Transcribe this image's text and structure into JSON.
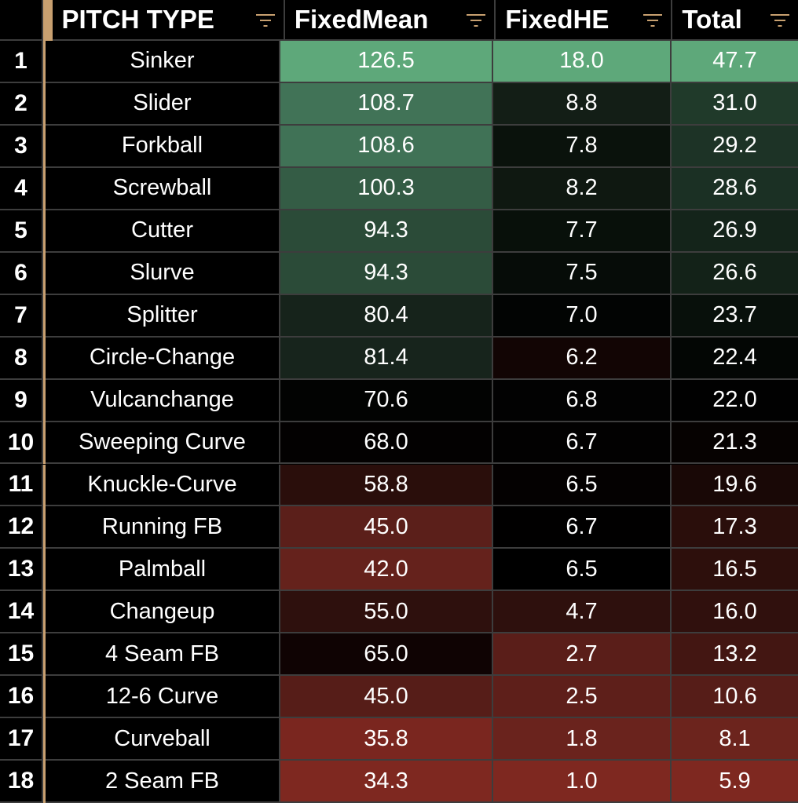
{
  "headers": {
    "pitch_type": "PITCH TYPE",
    "fixed_mean": "FixedMean",
    "fixed_he": "FixedHE",
    "total": "Total"
  },
  "colors": {
    "filter_icon": "#c8a070",
    "freeze_divider": "#c8a070",
    "grid_line": "#3d3d3d",
    "scale_high": "#5ea87a",
    "scale_mid": "#000000",
    "scale_low": "#7e2820"
  },
  "rows": [
    {
      "num": "1",
      "name": "Sinker",
      "fm": "126.5",
      "he": "18.0",
      "tot": "47.7",
      "fm_bg": "#5ea87a",
      "he_bg": "#5ea87a",
      "tot_bg": "#5ea87a"
    },
    {
      "num": "2",
      "name": "Slider",
      "fm": "108.7",
      "he": "8.8",
      "tot": "31.0",
      "fm_bg": "#417357",
      "he_bg": "#131e16",
      "tot_bg": "#203a2a"
    },
    {
      "num": "3",
      "name": "Forkball",
      "fm": "108.6",
      "he": "7.8",
      "tot": "29.2",
      "fm_bg": "#407256",
      "he_bg": "#0a120c",
      "tot_bg": "#1d3326"
    },
    {
      "num": "4",
      "name": "Screwball",
      "fm": "100.3",
      "he": "8.2",
      "tot": "28.6",
      "fm_bg": "#345c45",
      "he_bg": "#0f1811",
      "tot_bg": "#1b3024"
    },
    {
      "num": "5",
      "name": "Cutter",
      "fm": "94.3",
      "he": "7.7",
      "tot": "26.9",
      "fm_bg": "#2b4b38",
      "he_bg": "#08100a",
      "tot_bg": "#14241a"
    },
    {
      "num": "6",
      "name": "Slurve",
      "fm": "94.3",
      "he": "7.5",
      "tot": "26.6",
      "fm_bg": "#2b4b38",
      "he_bg": "#060c08",
      "tot_bg": "#132218"
    },
    {
      "num": "7",
      "name": "Splitter",
      "fm": "80.4",
      "he": "7.0",
      "tot": "23.7",
      "fm_bg": "#16231b",
      "he_bg": "#020403",
      "tot_bg": "#08100b"
    },
    {
      "num": "8",
      "name": "Circle-Change",
      "fm": "81.4",
      "he": "6.2",
      "tot": "22.4",
      "fm_bg": "#17241c",
      "he_bg": "#120504",
      "tot_bg": "#030604"
    },
    {
      "num": "9",
      "name": "Vulcanchange",
      "fm": "70.6",
      "he": "6.8",
      "tot": "22.0",
      "fm_bg": "#020302",
      "he_bg": "#020202",
      "tot_bg": "#010101"
    },
    {
      "num": "10",
      "name": "Sweeping Curve",
      "fm": "68.0",
      "he": "6.7",
      "tot": "21.3",
      "fm_bg": "#030101",
      "he_bg": "#020101",
      "tot_bg": "#060201"
    },
    {
      "num": "11",
      "name": "Knuckle-Curve",
      "fm": "58.8",
      "he": "6.5",
      "tot": "19.6",
      "fm_bg": "#2a0e0b",
      "he_bg": "#040101",
      "tot_bg": "#190806"
    },
    {
      "num": "12",
      "name": "Running FB",
      "fm": "45.0",
      "he": "6.7",
      "tot": "17.3",
      "fm_bg": "#5b1f1a",
      "he_bg": "#010000",
      "tot_bg": "#2a0e0b"
    },
    {
      "num": "13",
      "name": "Palmball",
      "fm": "42.0",
      "he": "6.5",
      "tot": "16.5",
      "fm_bg": "#65221c",
      "he_bg": "#000000",
      "tot_bg": "#2d0f0c"
    },
    {
      "num": "14",
      "name": "Changeup",
      "fm": "55.0",
      "he": "4.7",
      "tot": "16.0",
      "fm_bg": "#2e100d",
      "he_bg": "#2e100d",
      "tot_bg": "#30100d"
    },
    {
      "num": "15",
      "name": "4 Seam FB",
      "fm": "65.0",
      "he": "2.7",
      "tot": "13.2",
      "fm_bg": "#0f0303",
      "he_bg": "#5a1e19",
      "tot_bg": "#431612"
    },
    {
      "num": "16",
      "name": "12-6 Curve",
      "fm": "45.0",
      "he": "2.5",
      "tot": "10.6",
      "fm_bg": "#561d18",
      "he_bg": "#5e1f1a",
      "tot_bg": "#561d18"
    },
    {
      "num": "17",
      "name": "Curveball",
      "fm": "35.8",
      "he": "1.8",
      "tot": "8.1",
      "fm_bg": "#7a261f",
      "he_bg": "#6a231d",
      "tot_bg": "#6c241d"
    },
    {
      "num": "18",
      "name": "2 Seam FB",
      "fm": "34.3",
      "he": "1.0",
      "tot": "5.9",
      "fm_bg": "#7e2820",
      "he_bg": "#7e2820",
      "tot_bg": "#7e2820"
    }
  ]
}
